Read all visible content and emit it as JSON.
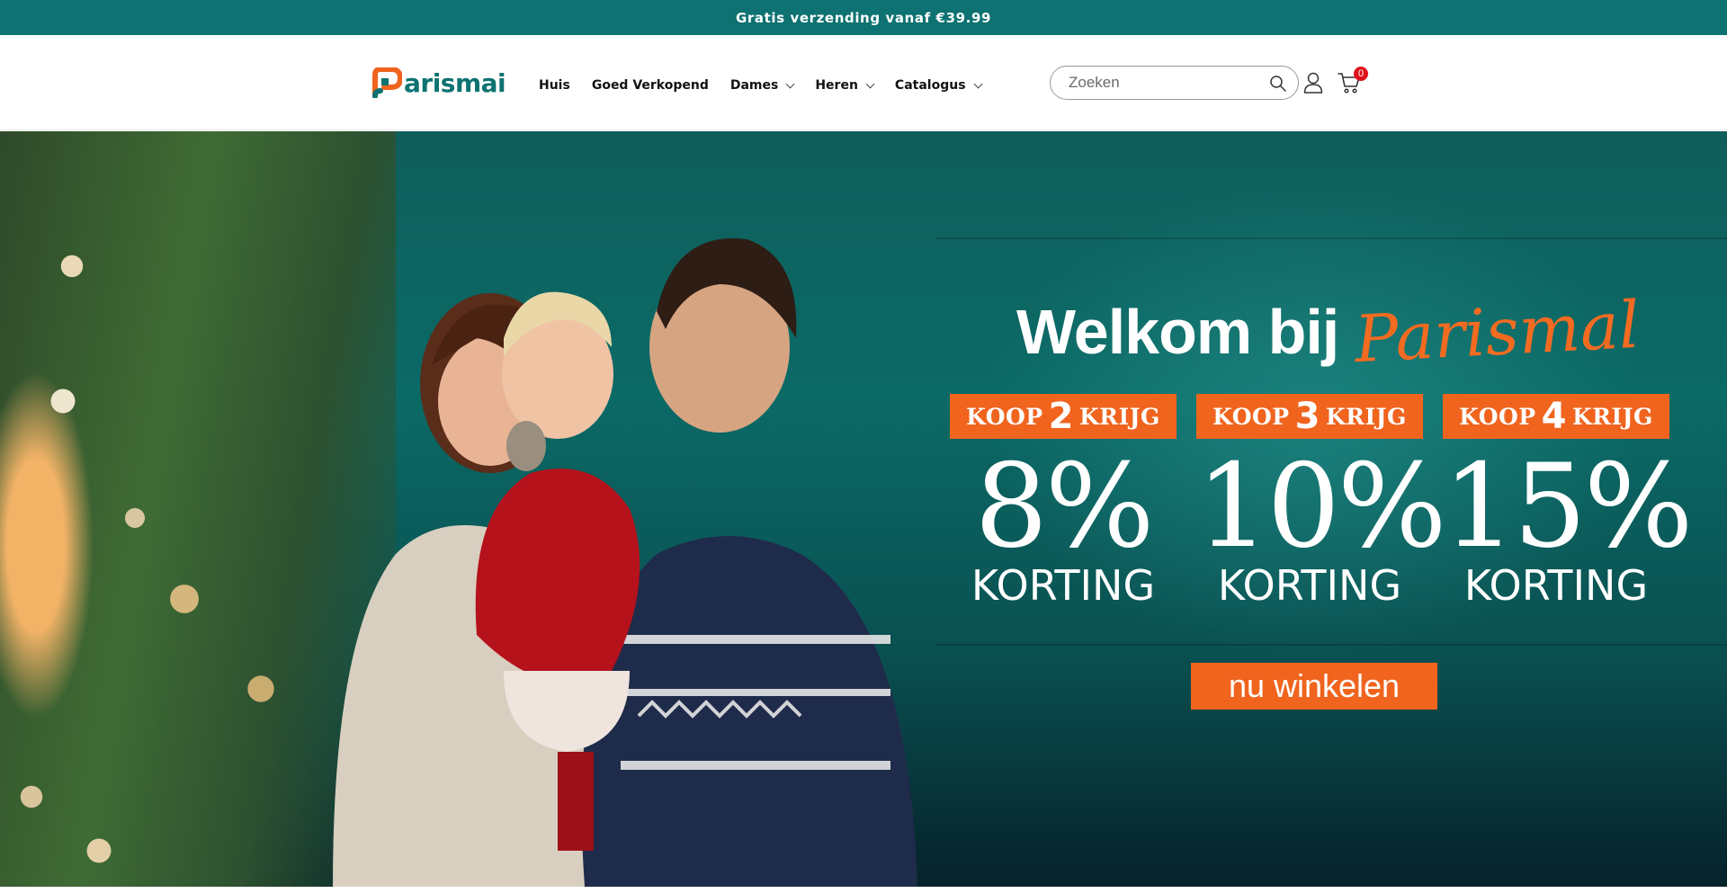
{
  "announcement": {
    "text": "Gratis verzending vanaf €39.99"
  },
  "header": {
    "logo_text": "arismai",
    "nav": [
      {
        "label": "Huis",
        "has_dropdown": false
      },
      {
        "label": "Goed Verkopend",
        "has_dropdown": false
      },
      {
        "label": "Dames",
        "has_dropdown": true
      },
      {
        "label": "Heren",
        "has_dropdown": true
      },
      {
        "label": "Catalogus",
        "has_dropdown": true
      }
    ],
    "search": {
      "placeholder": "Zoeken"
    },
    "cart": {
      "count": "0"
    }
  },
  "hero": {
    "welcome": "Welkom bij",
    "brand_script": "Parismal",
    "offers": [
      {
        "tag_prefix": "KOOP",
        "tag_number": "2",
        "tag_suffix": "KRIJG",
        "percent": "8%",
        "label": "KORTING"
      },
      {
        "tag_prefix": "KOOP",
        "tag_number": "3",
        "tag_suffix": "KRIJG",
        "percent": "10%",
        "label": "KORTING"
      },
      {
        "tag_prefix": "KOOP",
        "tag_number": "4",
        "tag_suffix": "KRIJG",
        "percent": "15%",
        "label": "KORTING"
      }
    ],
    "cta_label": "nu winkelen"
  },
  "colors": {
    "teal": "#0d7271",
    "orange": "#f0641e",
    "badge_red": "#e0111b"
  },
  "icons": [
    "search-icon",
    "account-icon",
    "cart-icon",
    "chevron-down-icon"
  ]
}
